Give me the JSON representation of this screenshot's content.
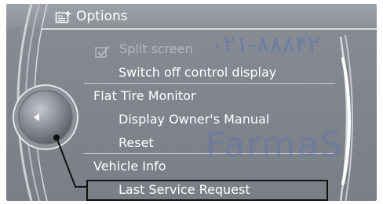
{
  "header": {
    "title": "Options",
    "icon": "options-icon"
  },
  "menu": {
    "items": [
      {
        "label": "Split screen",
        "icon": "checkbox-icon",
        "enabled": false
      },
      {
        "label": "Switch off control display"
      },
      {
        "label": "Flat Tire Monitor"
      },
      {
        "label": "Display Owner's Manual"
      },
      {
        "label": "Reset"
      },
      {
        "label": "Vehicle Info"
      },
      {
        "label": "Last Service Request",
        "selected": true
      }
    ]
  },
  "watermark": {
    "arabic": "۰۲۱-۸۸۸۴۲",
    "latin": "FarmaS"
  },
  "colors": {
    "panel": "#858a92",
    "text": "#ffffff",
    "disabled_text": "#b4b8bf",
    "selection_border": "#111111",
    "watermark": "#5a74b0"
  }
}
